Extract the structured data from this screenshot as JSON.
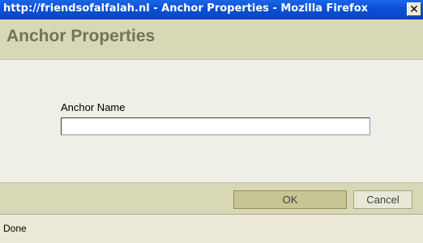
{
  "window": {
    "title": "http://friendsofalfalah.nl - Anchor Properties - Mozilla Firefox",
    "close_label": "✕"
  },
  "dialog": {
    "heading": "Anchor Properties",
    "field": {
      "label": "Anchor Name",
      "value": "",
      "placeholder": ""
    },
    "buttons": {
      "ok": "OK",
      "cancel": "Cancel"
    }
  },
  "statusbar": {
    "text": "Done"
  },
  "colors": {
    "titlebar": "#0a50d6",
    "header_bg": "#d8d8b6",
    "header_text": "#737357",
    "ok_button": "#c6c694"
  }
}
